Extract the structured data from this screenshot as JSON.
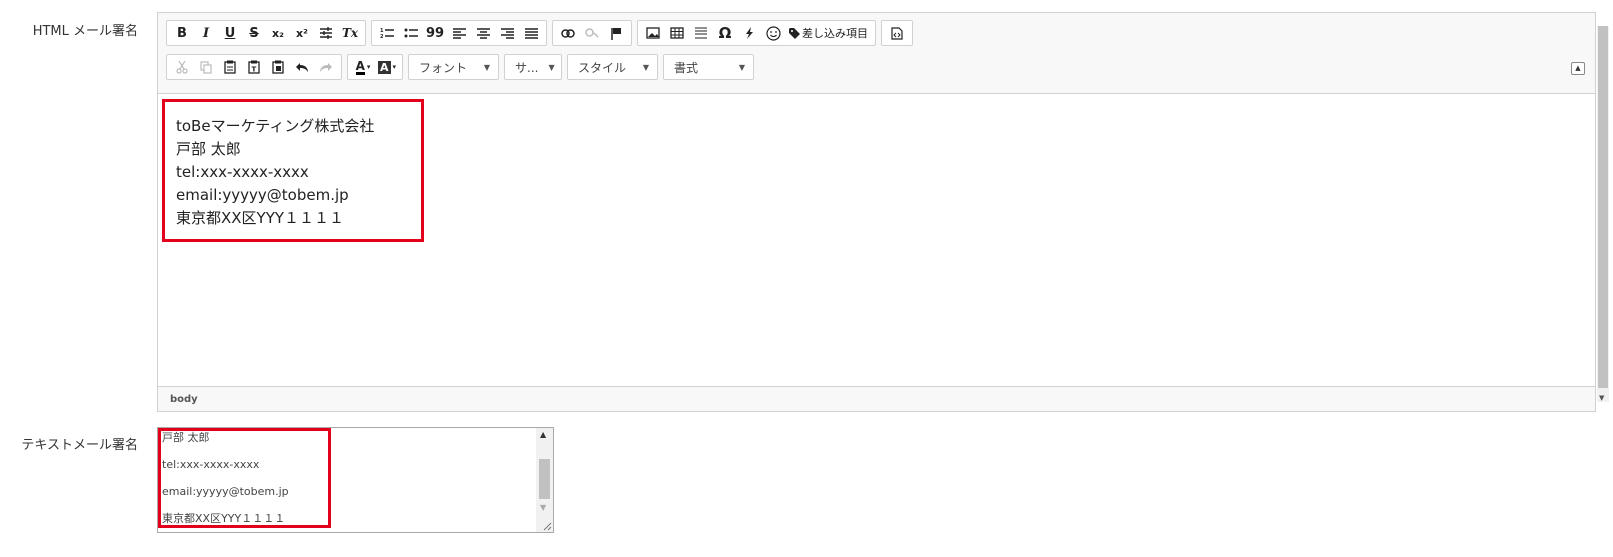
{
  "labels": {
    "html_signature": "HTML メール署名",
    "text_signature": "テキストメール署名"
  },
  "toolbar": {
    "row1": {
      "bold": "B",
      "italic": "I",
      "underline": "U",
      "strike": "S",
      "subscript": "x₂",
      "superscript": "x²",
      "remove_format": "Tx",
      "blockquote": "99",
      "special_char": "Ω",
      "merge_field_label": "差し込み項目"
    },
    "row2": {
      "font_combo": "フォント",
      "size_combo": "サ...",
      "style_combo": "スタイル",
      "format_combo": "書式",
      "text_color": "A",
      "bg_color": "A"
    }
  },
  "editor": {
    "lines": [
      "toBeマーケティング株式会社",
      "戸部 太郎",
      "tel:xxx-xxxx-xxxx",
      "email:yyyyy@tobem.jp",
      "東京都XX区YYY１１１１"
    ],
    "status_path": "body"
  },
  "textarea": {
    "lines": [
      "戸部 太郎",
      "tel:xxx-xxxx-xxxx",
      "email:yyyyy@tobem.jp",
      "東京都XX区YYY１１１１"
    ]
  },
  "colors": {
    "highlight": "#e3001b",
    "toolbar_bg": "#f8f8f8",
    "border": "#d1d1d1"
  }
}
